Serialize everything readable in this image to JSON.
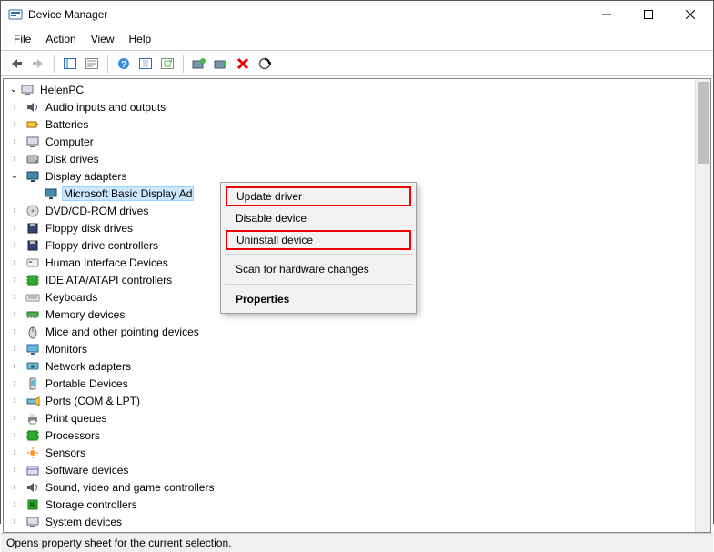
{
  "window": {
    "title": "Device Manager"
  },
  "menu": {
    "file": "File",
    "action": "Action",
    "view": "View",
    "help": "Help"
  },
  "toolbar_icons": {
    "back": "back-icon",
    "forward": "forward-icon",
    "show": "show-icon",
    "props": "properties-icon",
    "help": "help-icon",
    "wizard": "wizard-icon",
    "refresh": "refresh-icon",
    "update": "update-icon",
    "enable": "enable-icon",
    "uninstall": "uninstall-icon",
    "scan": "scan-icon"
  },
  "tree": {
    "root": "HelenPC",
    "items": {
      "audio": "Audio inputs and outputs",
      "batteries": "Batteries",
      "computer": "Computer",
      "disk": "Disk drives",
      "display": "Display adapters",
      "display_child": "Microsoft Basic Display Ad",
      "dvd": "DVD/CD-ROM drives",
      "floppy_disk": "Floppy disk drives",
      "floppy_ctrl": "Floppy drive controllers",
      "hid": "Human Interface Devices",
      "ide": "IDE ATA/ATAPI controllers",
      "keyboards": "Keyboards",
      "memory": "Memory devices",
      "mice": "Mice and other pointing devices",
      "monitors": "Monitors",
      "network": "Network adapters",
      "portable": "Portable Devices",
      "ports": "Ports (COM & LPT)",
      "print": "Print queues",
      "processors": "Processors",
      "sensors": "Sensors",
      "software": "Software devices",
      "sound": "Sound, video and game controllers",
      "storage": "Storage controllers",
      "system": "System devices"
    }
  },
  "context": {
    "update": "Update driver",
    "disable": "Disable device",
    "uninstall": "Uninstall device",
    "scan": "Scan for hardware changes",
    "properties": "Properties"
  },
  "status": "Opens property sheet for the current selection."
}
